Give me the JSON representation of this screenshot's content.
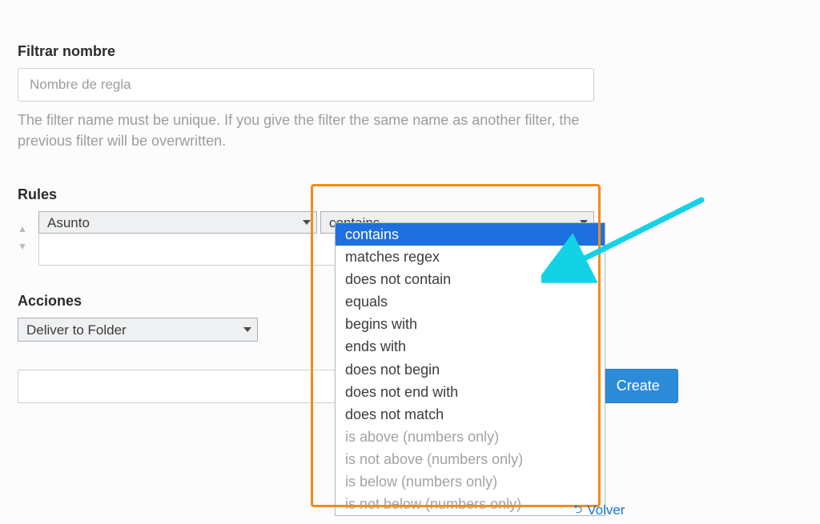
{
  "filter_name": {
    "label": "Filtrar nombre",
    "placeholder": "Nombre de regla",
    "help": "The filter name must be unique. If you give the filter the same name as another filter, the previous filter will be overwritten."
  },
  "rules": {
    "label": "Rules",
    "subject_selected": "Asunto",
    "operator_selected": "contains",
    "operator_options": [
      {
        "label": "contains",
        "selected": true,
        "disabled": false
      },
      {
        "label": "matches regex",
        "selected": false,
        "disabled": false
      },
      {
        "label": "does not contain",
        "selected": false,
        "disabled": false
      },
      {
        "label": "equals",
        "selected": false,
        "disabled": false
      },
      {
        "label": "begins with",
        "selected": false,
        "disabled": false
      },
      {
        "label": "ends with",
        "selected": false,
        "disabled": false
      },
      {
        "label": "does not begin",
        "selected": false,
        "disabled": false
      },
      {
        "label": "does not end with",
        "selected": false,
        "disabled": false
      },
      {
        "label": "does not match",
        "selected": false,
        "disabled": false
      },
      {
        "label": "is above (numbers only)",
        "selected": false,
        "disabled": true
      },
      {
        "label": "is not above (numbers only)",
        "selected": false,
        "disabled": true
      },
      {
        "label": "is below (numbers only)",
        "selected": false,
        "disabled": true
      },
      {
        "label": "is not below (numbers only)",
        "selected": false,
        "disabled": true
      }
    ]
  },
  "actions": {
    "label": "Acciones",
    "selected": "Deliver to Folder"
  },
  "buttons": {
    "create": "Create"
  },
  "volver": {
    "label": "Volver"
  }
}
